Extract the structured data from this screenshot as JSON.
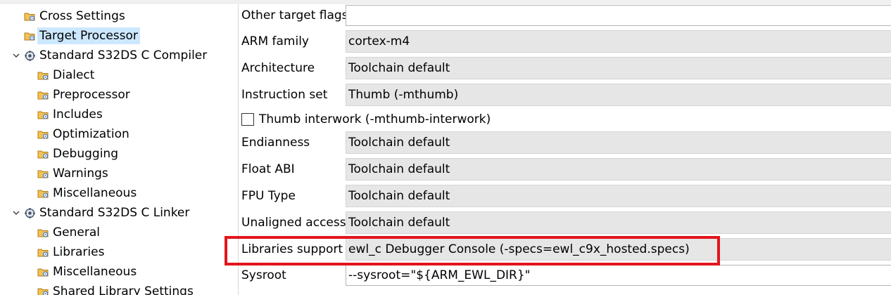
{
  "tree": {
    "items": [
      {
        "label": "Cross Settings",
        "icon": "settings-folder-icon"
      },
      {
        "label": "Target Processor",
        "icon": "settings-folder-icon",
        "selected": true
      },
      {
        "label": "Standard S32DS C Compiler",
        "icon": "tool-gear-icon",
        "expanded": true
      },
      {
        "label": "Dialect",
        "icon": "settings-folder-icon"
      },
      {
        "label": "Preprocessor",
        "icon": "settings-folder-icon"
      },
      {
        "label": "Includes",
        "icon": "settings-folder-icon"
      },
      {
        "label": "Optimization",
        "icon": "settings-folder-icon"
      },
      {
        "label": "Debugging",
        "icon": "settings-folder-icon"
      },
      {
        "label": "Warnings",
        "icon": "settings-folder-icon"
      },
      {
        "label": "Miscellaneous",
        "icon": "settings-folder-icon"
      },
      {
        "label": "Standard S32DS C Linker",
        "icon": "tool-gear-icon",
        "expanded": true
      },
      {
        "label": "General",
        "icon": "settings-folder-icon"
      },
      {
        "label": "Libraries",
        "icon": "settings-folder-icon"
      },
      {
        "label": "Miscellaneous",
        "icon": "settings-folder-icon"
      },
      {
        "label": "Shared Library Settings",
        "icon": "settings-folder-icon"
      }
    ]
  },
  "form": {
    "other_target_flags": {
      "label": "Other target flags",
      "value": ""
    },
    "arm_family": {
      "label": "ARM family",
      "value": "cortex-m4"
    },
    "architecture": {
      "label": "Architecture",
      "value": "Toolchain default"
    },
    "instruction_set": {
      "label": "Instruction set",
      "value": "Thumb (-mthumb)"
    },
    "thumb_interwork": {
      "label": "Thumb interwork (-mthumb-interwork)",
      "checked": false
    },
    "endianness": {
      "label": "Endianness",
      "value": "Toolchain default"
    },
    "float_abi": {
      "label": "Float ABI",
      "value": "Toolchain default"
    },
    "fpu_type": {
      "label": "FPU Type",
      "value": "Toolchain default"
    },
    "unaligned_access": {
      "label": "Unaligned access",
      "value": "Toolchain default"
    },
    "libraries_support": {
      "label": "Libraries support",
      "value": "ewl_c Debugger Console (-specs=ewl_c9x_hosted.specs)"
    },
    "sysroot": {
      "label": "Sysroot",
      "value": "--sysroot=\"${ARM_EWL_DIR}\""
    }
  },
  "colors": {
    "selection": "#cce8ff",
    "highlight": "#e2151b",
    "readonly_field": "#e6e6e6"
  }
}
